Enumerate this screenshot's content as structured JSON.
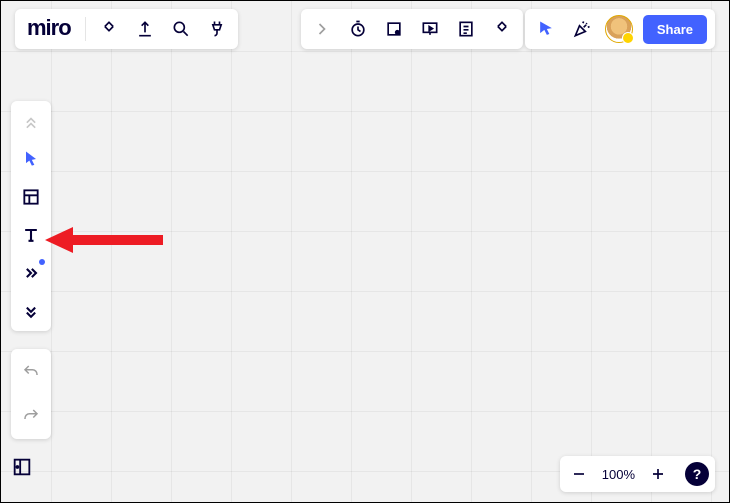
{
  "app": {
    "logo": "miro"
  },
  "topbar": {
    "share_label": "Share"
  },
  "zoom": {
    "level": "100%",
    "help": "?"
  },
  "icons": {
    "board_menu": "board-menu",
    "upload": "upload",
    "search": "search",
    "plug": "plug",
    "expand_right": "expand-right",
    "timer": "timer",
    "frame": "frame",
    "present": "present",
    "notes": "notes",
    "more": "more",
    "cursor_tool": "cursor-tool",
    "celebrate": "celebrate",
    "collapse_up": "collapse-up",
    "select": "select",
    "templates": "templates",
    "text": "text",
    "more_tools": "more-tools",
    "expand_down": "expand-down",
    "undo": "undo",
    "redo": "redo",
    "panels": "panels",
    "zoom_out": "zoom-out",
    "zoom_in": "zoom-in"
  }
}
